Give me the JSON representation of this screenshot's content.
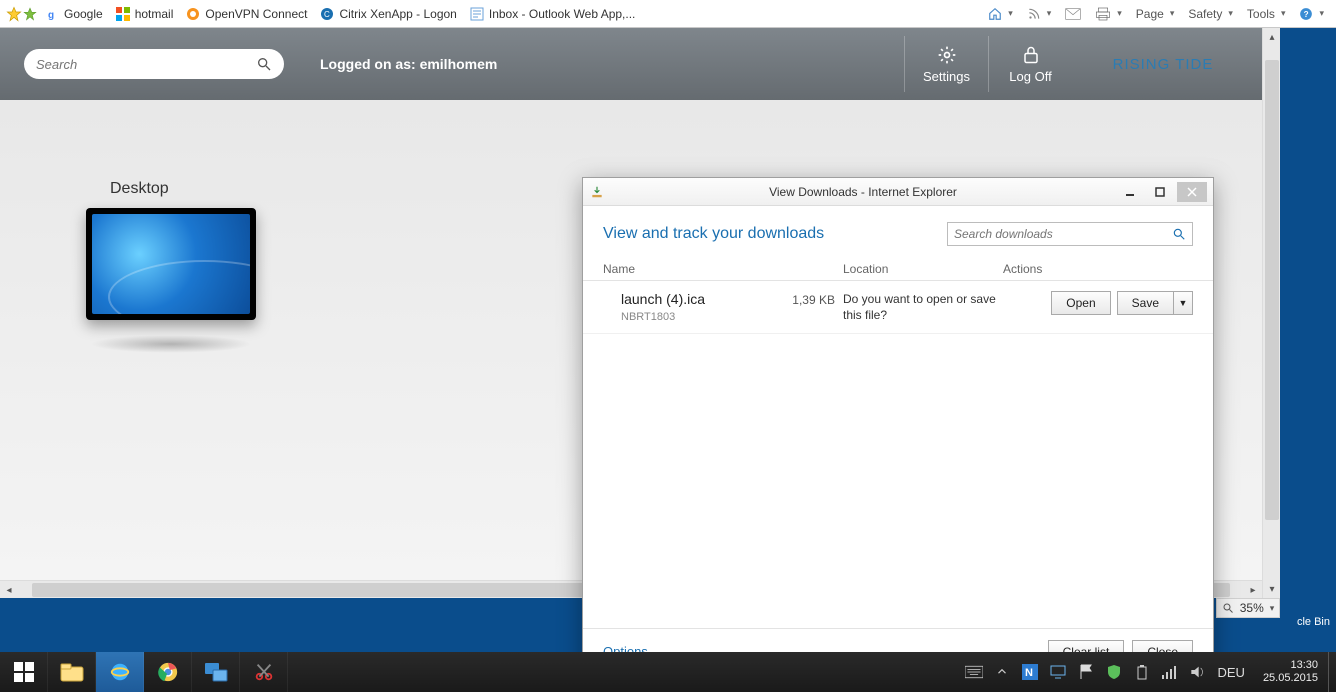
{
  "favorites": {
    "items": [
      {
        "label": "Google"
      },
      {
        "label": "hotmail"
      },
      {
        "label": "OpenVPN Connect"
      },
      {
        "label": "Citrix XenApp - Logon"
      },
      {
        "label": "Inbox - Outlook Web App,..."
      }
    ],
    "right_menu": {
      "page": "Page",
      "safety": "Safety",
      "tools": "Tools"
    }
  },
  "citrix": {
    "search_placeholder": "Search",
    "logged_on_prefix": "Logged on as: ",
    "username": "emilhomem",
    "settings_label": "Settings",
    "logoff_label": "Log Off",
    "brand": "RISING TIDE",
    "desktop_label": "Desktop"
  },
  "zoom": {
    "value": "35%"
  },
  "desktop_strip": {
    "recycle_bin": "cle Bin"
  },
  "downloads": {
    "window_title": "View Downloads - Internet Explorer",
    "heading": "View and track your downloads",
    "search_placeholder": "Search downloads",
    "columns": {
      "name": "Name",
      "location": "Location",
      "actions": "Actions"
    },
    "row": {
      "filename": "launch (4).ica",
      "source": "NBRT1803",
      "size": "1,39 KB",
      "prompt": "Do you want to open or save this file?",
      "open_label": "Open",
      "save_label": "Save"
    },
    "options_label": "Options",
    "clear_label": "Clear list",
    "close_label": "Close"
  },
  "taskbar": {
    "lang": "DEU",
    "time": "13:30",
    "date": "25.05.2015"
  }
}
